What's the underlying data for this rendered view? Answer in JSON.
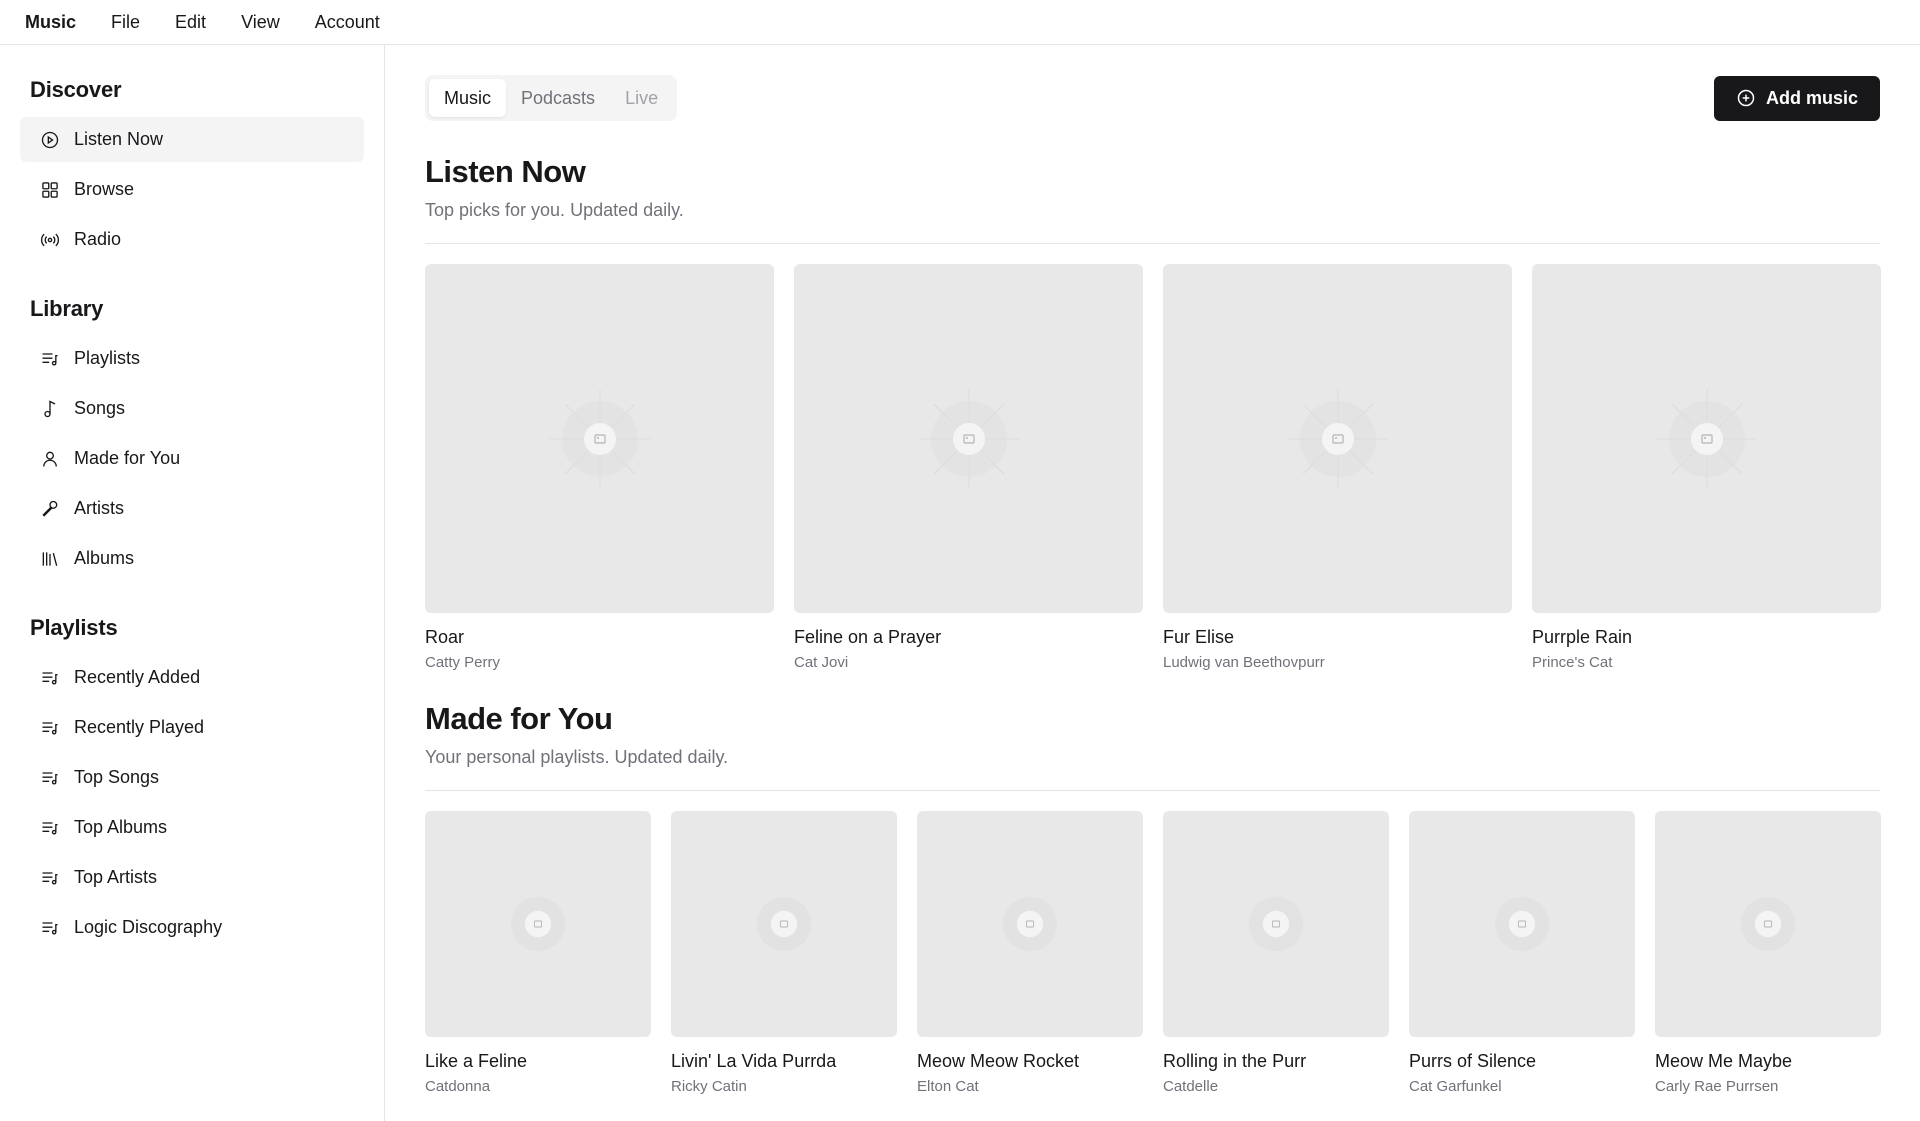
{
  "menu": {
    "brand": "Music",
    "items": [
      "File",
      "Edit",
      "View",
      "Account"
    ]
  },
  "sidebar": {
    "discover": {
      "heading": "Discover",
      "items": [
        {
          "label": "Listen Now",
          "icon": "play-circle-icon",
          "active": true
        },
        {
          "label": "Browse",
          "icon": "grid-icon"
        },
        {
          "label": "Radio",
          "icon": "radio-icon"
        }
      ]
    },
    "library": {
      "heading": "Library",
      "items": [
        {
          "label": "Playlists",
          "icon": "playlist-icon"
        },
        {
          "label": "Songs",
          "icon": "music-note-icon"
        },
        {
          "label": "Made for You",
          "icon": "user-icon"
        },
        {
          "label": "Artists",
          "icon": "microphone-icon"
        },
        {
          "label": "Albums",
          "icon": "library-icon"
        }
      ]
    },
    "playlists": {
      "heading": "Playlists",
      "items": [
        {
          "label": "Recently Added",
          "icon": "playlist-icon"
        },
        {
          "label": "Recently Played",
          "icon": "playlist-icon"
        },
        {
          "label": "Top Songs",
          "icon": "playlist-icon"
        },
        {
          "label": "Top Albums",
          "icon": "playlist-icon"
        },
        {
          "label": "Top Artists",
          "icon": "playlist-icon"
        },
        {
          "label": "Logic Discography",
          "icon": "playlist-icon"
        }
      ]
    }
  },
  "tabs": [
    {
      "label": "Music",
      "state": "active"
    },
    {
      "label": "Podcasts",
      "state": "normal"
    },
    {
      "label": "Live",
      "state": "disabled"
    }
  ],
  "add_button": {
    "label": "Add music",
    "icon": "plus-circle-icon"
  },
  "listen_now": {
    "title": "Listen Now",
    "subtitle": "Top picks for you. Updated daily.",
    "albums": [
      {
        "title": "Roar",
        "artist": "Catty Perry"
      },
      {
        "title": "Feline on a Prayer",
        "artist": "Cat Jovi"
      },
      {
        "title": "Fur Elise",
        "artist": "Ludwig van Beethovpurr"
      },
      {
        "title": "Purrple Rain",
        "artist": "Prince's Cat"
      }
    ]
  },
  "made_for_you": {
    "title": "Made for You",
    "subtitle": "Your personal playlists. Updated daily.",
    "albums": [
      {
        "title": "Like a Feline",
        "artist": "Catdonna"
      },
      {
        "title": "Livin' La Vida Purrda",
        "artist": "Ricky Catin"
      },
      {
        "title": "Meow Meow Rocket",
        "artist": "Elton Cat"
      },
      {
        "title": "Rolling in the Purr",
        "artist": "Catdelle"
      },
      {
        "title": "Purrs of Silence",
        "artist": "Cat Garfunkel"
      },
      {
        "title": "Meow Me Maybe",
        "artist": "Carly Rae Purrsen"
      }
    ]
  },
  "colors": {
    "accent": "#18181b",
    "muted_text": "#71717a",
    "placeholder": "#e8e8e8",
    "border": "#e4e4e7"
  }
}
